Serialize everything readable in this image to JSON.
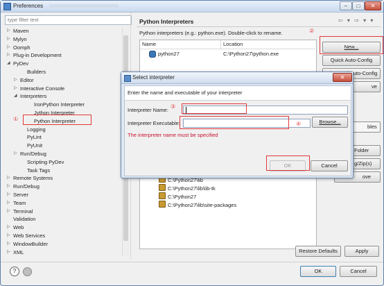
{
  "window": {
    "title": "Preferences",
    "controls": [
      "–",
      "□",
      "✕"
    ]
  },
  "filter": {
    "placeholder": "type filter text"
  },
  "tree": [
    {
      "label": "Maven",
      "arrow": "▷"
    },
    {
      "label": "Mylyn",
      "arrow": "▷"
    },
    {
      "label": "Oomph",
      "arrow": "▷"
    },
    {
      "label": "Plug-in Development",
      "arrow": "▷"
    },
    {
      "label": "PyDev",
      "arrow": "◢"
    },
    {
      "label": "Builders",
      "arrow": ""
    },
    {
      "label": "Editor",
      "arrow": "▷"
    },
    {
      "label": "Interactive Console",
      "arrow": "▷"
    },
    {
      "label": "Interpreters",
      "arrow": "◢"
    },
    {
      "label": "IronPython Interpreter",
      "arrow": ""
    },
    {
      "label": "Jython Interpreter",
      "arrow": ""
    },
    {
      "label": "Python Interpreter",
      "arrow": ""
    },
    {
      "label": "Logging",
      "arrow": ""
    },
    {
      "label": "PyLint",
      "arrow": ""
    },
    {
      "label": "PyUnit",
      "arrow": ""
    },
    {
      "label": "Run/Debug",
      "arrow": "▷"
    },
    {
      "label": "Scripting PyDev",
      "arrow": ""
    },
    {
      "label": "Task Tags",
      "arrow": ""
    },
    {
      "label": "Remote Systems",
      "arrow": "▷"
    },
    {
      "label": "Run/Debug",
      "arrow": "▷"
    },
    {
      "label": "Server",
      "arrow": "▷"
    },
    {
      "label": "Team",
      "arrow": "▷"
    },
    {
      "label": "Terminal",
      "arrow": "▷"
    },
    {
      "label": "Validation",
      "arrow": ""
    },
    {
      "label": "Web",
      "arrow": "▷"
    },
    {
      "label": "Web Services",
      "arrow": "▷"
    },
    {
      "label": "WindowBuilder",
      "arrow": "▷"
    },
    {
      "label": "XML",
      "arrow": "▷"
    }
  ],
  "panel": {
    "title": "Python Interpreters",
    "nav": "⇦ ▾ ⇨ ▾ ▾",
    "description": "Python interpreters (e.g.: python.exe).   Double-click to rename.",
    "columns": {
      "name": "Name",
      "location": "Location"
    },
    "rows": [
      {
        "name": "python27",
        "location": "C:\\Python27\\python.exe"
      }
    ],
    "buttons": {
      "new": "New...",
      "quick": "Quick Auto-Config",
      "advanced": "Advanced Auto-Config",
      "remove_partial": "ve",
      "libraries_partial": "bles",
      "folder": "Folder",
      "zip": "g/Zip(s)",
      "remove2": "ove"
    },
    "paths": [
      "C:\\Python27\\lib",
      "C:\\Python27\\lib\\lib-tk",
      "C:\\Python27",
      "C:\\Python27\\lib\\site-packages"
    ],
    "restore": "Restore Defaults",
    "apply": "Apply"
  },
  "footer": {
    "ok": "OK",
    "cancel": "Cancel",
    "help": "?"
  },
  "dialog": {
    "title": "Select interpreter",
    "close": "✕",
    "header": "Enter the name and executable of your interpreter",
    "name_label": "Interpreter Name:",
    "name_value": "",
    "exe_label": "Interpreter Executable:",
    "exe_value": "",
    "browse": "Browse...",
    "error": "The interpreter name must be specified",
    "ok": "OK",
    "cancel": "Cancel"
  },
  "annotations": [
    "①",
    "②",
    "③",
    "④"
  ],
  "colors": {
    "annotation": "#e0393a",
    "error": "#c8102e"
  }
}
